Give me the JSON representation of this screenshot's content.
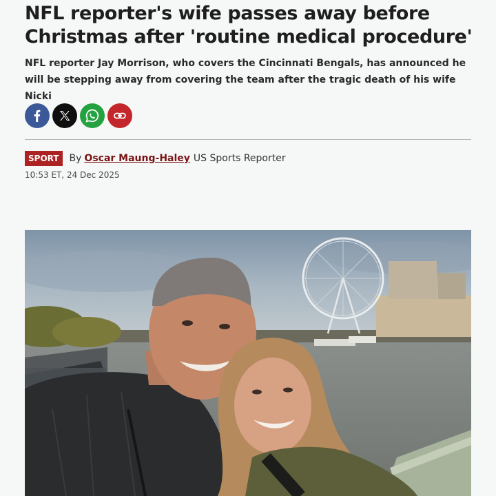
{
  "article": {
    "headline": "NFL reporter's wife passes away before Christmas after 'routine medical procedure'",
    "standfirst": "NFL reporter Jay Morrison, who covers the Cincinnati Bengals, has announced he will be stepping away from covering the team after the tragic death of his wife Nicki",
    "section": "SPORT",
    "byline_prefix": "By",
    "author": "Oscar Maung-Haley",
    "author_role": "US Sports Reporter",
    "timestamp": "10:53 ET, 24 Dec 2025"
  },
  "share": {
    "icons": [
      "facebook-icon",
      "x-icon",
      "whatsapp-icon",
      "link-icon"
    ]
  },
  "colors": {
    "section_badge": "#ad2222",
    "author_link": "#7a1414",
    "facebook": "#3b5998",
    "x": "#0f0f0f",
    "whatsapp": "#25a240",
    "copy_link": "#c3262b"
  }
}
